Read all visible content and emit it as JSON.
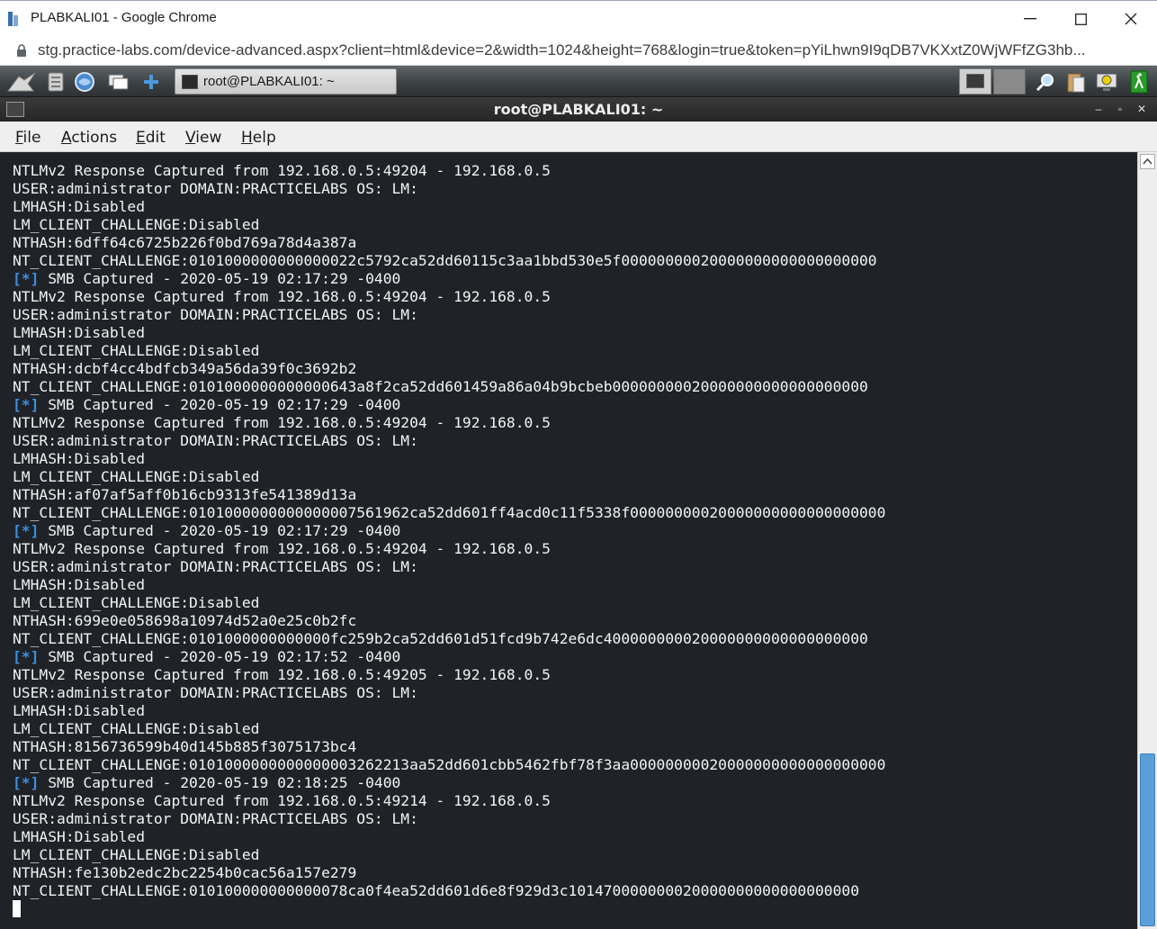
{
  "browser": {
    "window_title": "PLABKALI01 - Google Chrome",
    "url": "stg.practice-labs.com/device-advanced.aspx?client=html&device=2&width=1024&height=768&login=true&token=pYiLhwn9I9qDB7VKXxtZ0WjWFfZG3hb..."
  },
  "taskbar": {
    "active_window": "root@PLABKALI01: ~"
  },
  "terminal": {
    "title": "root@PLABKALI01: ~",
    "menu": [
      "File",
      "Actions",
      "Edit",
      "View",
      "Help"
    ],
    "prefix": "[*]",
    "lines": [
      {
        "text": "NTLMv2 Response Captured from 192.168.0.5:49204 - 192.168.0.5"
      },
      {
        "text": "USER:administrator DOMAIN:PRACTICELABS OS: LM:"
      },
      {
        "text": "LMHASH:Disabled"
      },
      {
        "text": "LM_CLIENT_CHALLENGE:Disabled"
      },
      {
        "text": "NTHASH:6dff64c6725b226f0bd769a78d4a387a"
      },
      {
        "text": "NT_CLIENT_CHALLENGE:0101000000000000022c5792ca52dd60115c3aa1bbd530e5f00000000020000000000000000000"
      },
      {
        "prefix": true,
        "text": " SMB Captured - 2020-05-19 02:17:29 -0400"
      },
      {
        "text": "NTLMv2 Response Captured from 192.168.0.5:49204 - 192.168.0.5"
      },
      {
        "text": "USER:administrator DOMAIN:PRACTICELABS OS: LM:"
      },
      {
        "text": "LMHASH:Disabled"
      },
      {
        "text": "LM_CLIENT_CHALLENGE:Disabled"
      },
      {
        "text": "NTHASH:dcbf4cc4bdfcb349a56da39f0c3692b2"
      },
      {
        "text": "NT_CLIENT_CHALLENGE:0101000000000000643a8f2ca52dd601459a86a04b9bcbeb00000000020000000000000000000"
      },
      {
        "prefix": true,
        "text": " SMB Captured - 2020-05-19 02:17:29 -0400"
      },
      {
        "text": "NTLMv2 Response Captured from 192.168.0.5:49204 - 192.168.0.5"
      },
      {
        "text": "USER:administrator DOMAIN:PRACTICELABS OS: LM:"
      },
      {
        "text": "LMHASH:Disabled"
      },
      {
        "text": "LM_CLIENT_CHALLENGE:Disabled"
      },
      {
        "text": "NTHASH:af07af5aff0b16cb9313fe541389d13a"
      },
      {
        "text": "NT_CLIENT_CHALLENGE:0101000000000000007561962ca52dd601ff4acd0c11f5338f00000000020000000000000000000"
      },
      {
        "prefix": true,
        "text": " SMB Captured - 2020-05-19 02:17:29 -0400"
      },
      {
        "text": "NTLMv2 Response Captured from 192.168.0.5:49204 - 192.168.0.5"
      },
      {
        "text": "USER:administrator DOMAIN:PRACTICELABS OS: LM:"
      },
      {
        "text": "LMHASH:Disabled"
      },
      {
        "text": "LM_CLIENT_CHALLENGE:Disabled"
      },
      {
        "text": "NTHASH:699e0e058698a10974d52a0e25c0b2fc"
      },
      {
        "text": "NT_CLIENT_CHALLENGE:0101000000000000fc259b2ca52dd601d51fcd9b742e6dc400000000020000000000000000000"
      },
      {
        "prefix": true,
        "text": " SMB Captured - 2020-05-19 02:17:52 -0400"
      },
      {
        "text": "NTLMv2 Response Captured from 192.168.0.5:49205 - 192.168.0.5"
      },
      {
        "text": "USER:administrator DOMAIN:PRACTICELABS OS: LM:"
      },
      {
        "text": "LMHASH:Disabled"
      },
      {
        "text": "LM_CLIENT_CHALLENGE:Disabled"
      },
      {
        "text": "NTHASH:8156736599b40d145b885f3075173bc4"
      },
      {
        "text": "NT_CLIENT_CHALLENGE:0101000000000000003262213aa52dd601cbb5462fbf78f3aa00000000020000000000000000000"
      },
      {
        "prefix": true,
        "text": " SMB Captured - 2020-05-19 02:18:25 -0400"
      },
      {
        "text": "NTLMv2 Response Captured from 192.168.0.5:49214 - 192.168.0.5"
      },
      {
        "text": "USER:administrator DOMAIN:PRACTICELABS OS: LM:"
      },
      {
        "text": "LMHASH:Disabled"
      },
      {
        "text": "LM_CLIENT_CHALLENGE:Disabled"
      },
      {
        "text": "NTHASH:fe130b2edc2bc2254b0cac56a157e279"
      },
      {
        "text": "NT_CLIENT_CHALLENGE:010100000000000078ca0f4ea52dd601d6e8f929d3c101470000000020000000000000000000"
      }
    ]
  },
  "colors": {
    "terminal_bg": "#1f2328",
    "terminal_fg": "#f2f2f2",
    "prefix_blue": "#3d8fe0"
  }
}
